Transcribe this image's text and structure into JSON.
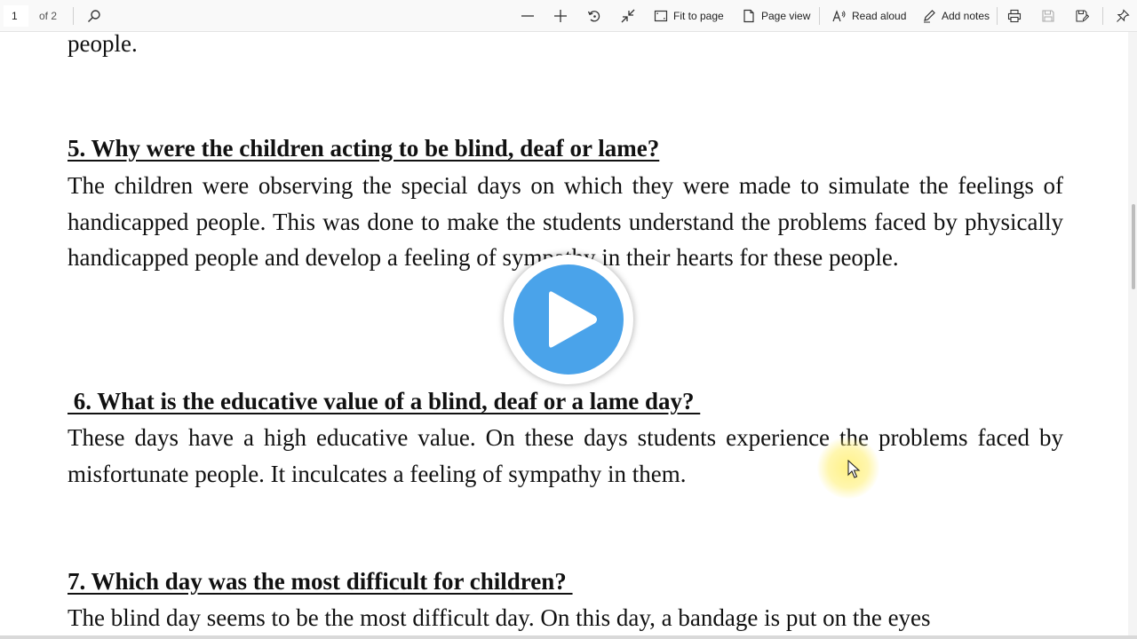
{
  "toolbar": {
    "page_number": "1",
    "page_of": "of 2",
    "fit_to_page": "Fit to page",
    "page_view": "Page view",
    "read_aloud": "Read aloud",
    "add_notes": "Add notes"
  },
  "document": {
    "top_fragment": "people.",
    "q5": {
      "heading": "5. Why were the children acting to be blind, deaf or lame?",
      "answer": "The children were observing the special days on which they were made to simulate the feelings of handicapped people. This was done to make the students understand the problems faced by physically handicapped people and develop a feeling of sympathy in their hearts for these people."
    },
    "q6": {
      "heading": " 6. What is the educative value of a blind, deaf or a lame day? ",
      "answer": "These days have a high educative value. On these days students experience the problems faced by misfortunate people. It inculcates a feeling of sympathy in them."
    },
    "q7": {
      "heading": "7. Which day was the most difficult for children? ",
      "answer": "The blind day seems to be the most difficult day. On this day, a bandage is put on the eyes"
    }
  },
  "colors": {
    "play_button": "#4aa3ea",
    "cursor_highlight": "#fff078"
  }
}
